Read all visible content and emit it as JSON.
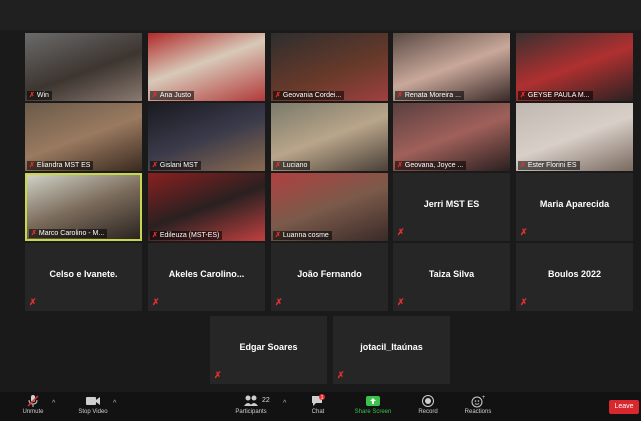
{
  "participants_grid": [
    {
      "name": "Win",
      "video": true
    },
    {
      "name": "Ana Justo",
      "video": true
    },
    {
      "name": "Geovania Cordei...",
      "video": true
    },
    {
      "name": "Renata Moreira ...",
      "video": true
    },
    {
      "name": "GEYSE PAULA M...",
      "video": true
    },
    {
      "name": "Eliandra MST ES",
      "video": true
    },
    {
      "name": "Gislani MST",
      "video": true
    },
    {
      "name": "Luciano",
      "video": true
    },
    {
      "name": "Geovana, Joyce ...",
      "video": true
    },
    {
      "name": "Ester Florini ES",
      "video": true
    },
    {
      "name": "Marco Carolino - M...",
      "video": true,
      "active": true
    },
    {
      "name": "Edileuza (MST-ES)",
      "video": true
    },
    {
      "name": "Luanna cosme",
      "video": true
    },
    {
      "name": "Jerri MST ES",
      "video": false
    },
    {
      "name": "Maria Aparecida",
      "video": false
    },
    {
      "name": "Celso e Ivanete.",
      "video": false
    },
    {
      "name": "Akeles  Carolino...",
      "video": false
    },
    {
      "name": "João Fernando",
      "video": false
    },
    {
      "name": "Taiza Silva",
      "video": false
    },
    {
      "name": "Boulos 2022",
      "video": false
    },
    {
      "name": "Edgar Soares",
      "video": false
    },
    {
      "name": "jotacil_Itaúnas",
      "video": false
    }
  ],
  "toolbar": {
    "unmute_label": "Unmute",
    "stop_video_label": "Stop Video",
    "participants_label": "Participants",
    "participants_count": "22",
    "chat_label": "Chat",
    "chat_badge": "1",
    "share_label": "Share Screen",
    "record_label": "Record",
    "reactions_label": "Reactions",
    "leave_label": "Leave"
  },
  "colors": {
    "active_speaker_border": "#c8d64a",
    "muted_red": "#e0302f",
    "share_green": "#3ac24a",
    "leave_red": "#d9272e"
  }
}
